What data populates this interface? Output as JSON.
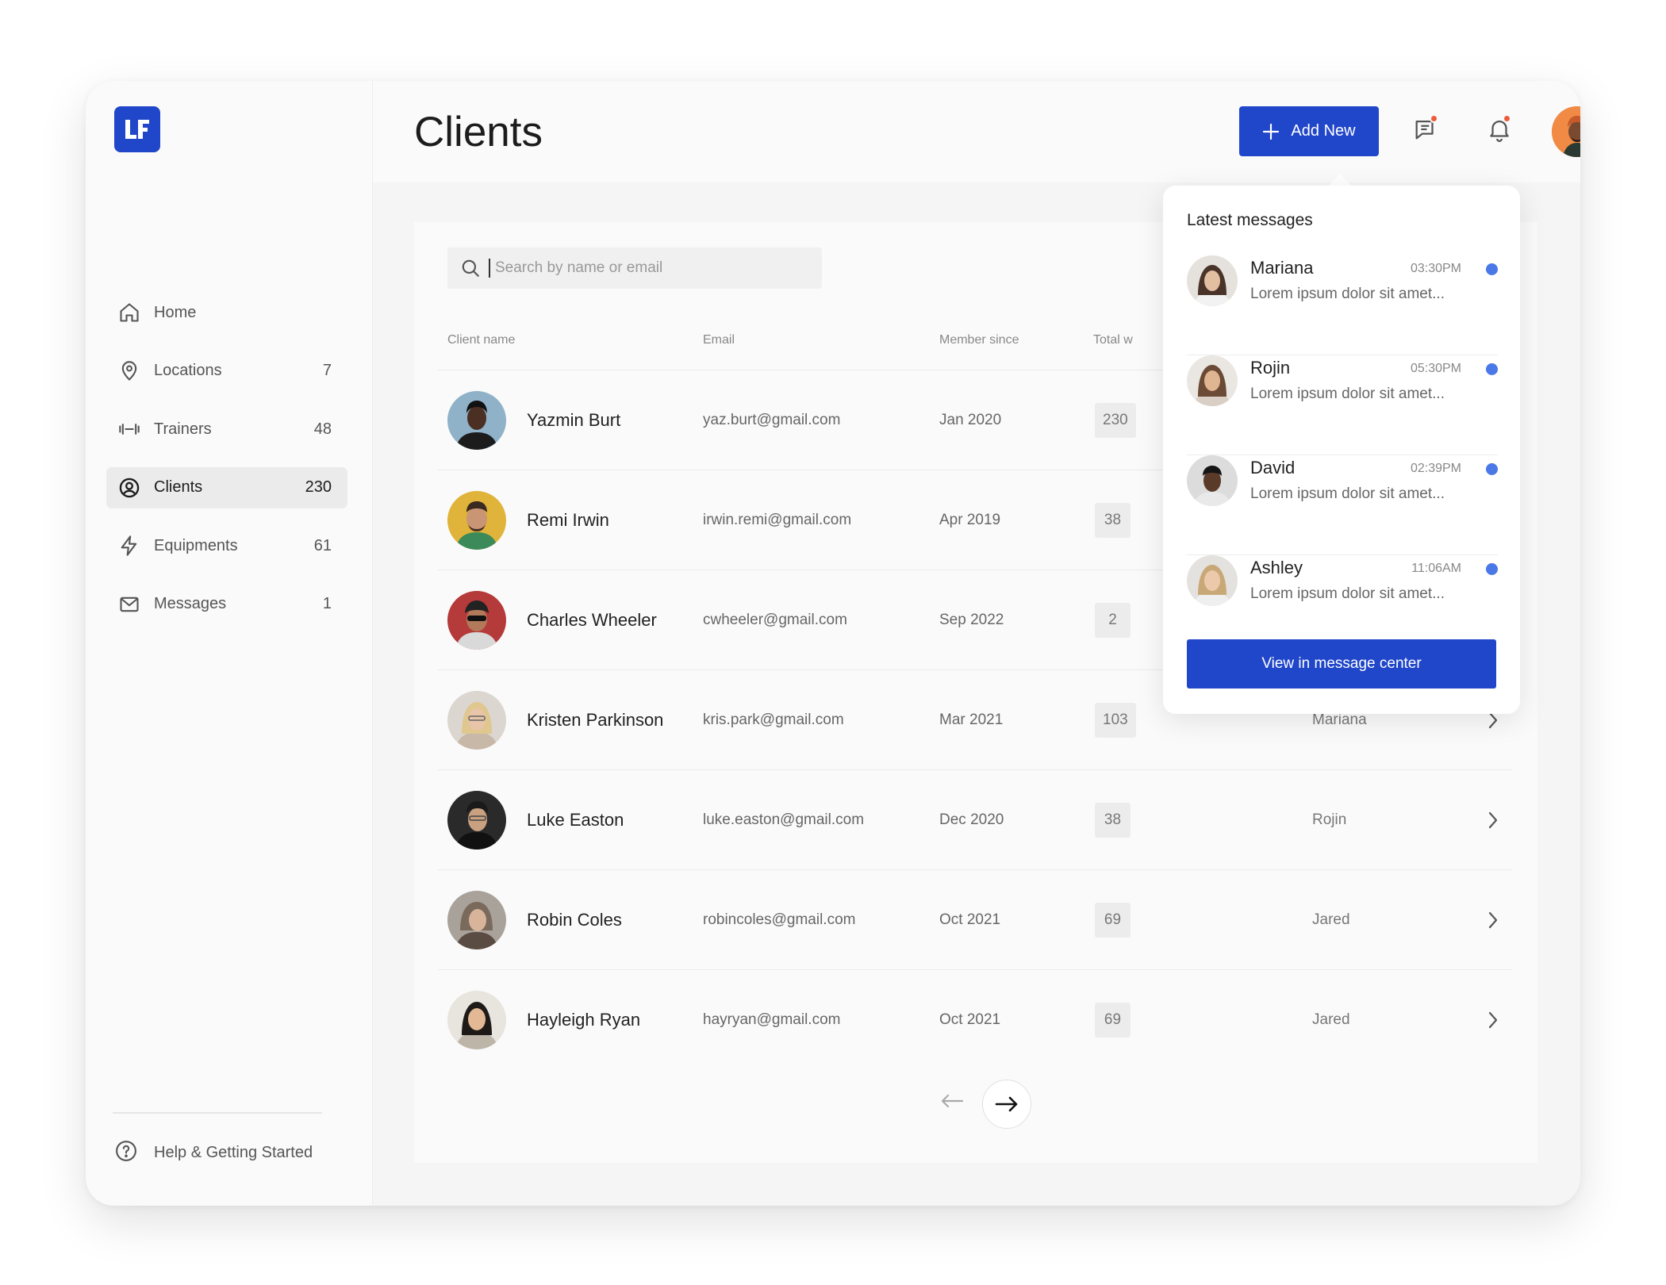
{
  "app": {
    "logo_text": "LF"
  },
  "sidebar": {
    "items": [
      {
        "label": "Home",
        "count": "",
        "icon": "home-icon"
      },
      {
        "label": "Locations",
        "count": "7",
        "icon": "location-pin-icon"
      },
      {
        "label": "Trainers",
        "count": "48",
        "icon": "dumbbell-icon"
      },
      {
        "label": "Clients",
        "count": "230",
        "icon": "user-circle-icon",
        "active": true
      },
      {
        "label": "Equipments",
        "count": "61",
        "icon": "lightning-icon"
      },
      {
        "label": "Messages",
        "count": "1",
        "icon": "mail-icon"
      }
    ],
    "help_label": "Help & Getting Started"
  },
  "header": {
    "title": "Clients",
    "add_label": "Add New"
  },
  "search": {
    "placeholder": "Search by name or email"
  },
  "table": {
    "columns": [
      "Client name",
      "Email",
      "Member since",
      "Total w"
    ],
    "rows": [
      {
        "name": "Yazmin Burt",
        "email": "yaz.burt@gmail.com",
        "since": "Jan 2020",
        "total": "230",
        "trainer": ""
      },
      {
        "name": "Remi Irwin",
        "email": "irwin.remi@gmail.com",
        "since": "Apr 2019",
        "total": "38",
        "trainer": ""
      },
      {
        "name": "Charles Wheeler",
        "email": "cwheeler@gmail.com",
        "since": "Sep 2022",
        "total": "2",
        "trainer": ""
      },
      {
        "name": "Kristen Parkinson",
        "email": "kris.park@gmail.com",
        "since": "Mar 2021",
        "total": "103",
        "trainer": "Mariana"
      },
      {
        "name": "Luke Easton",
        "email": "luke.easton@gmail.com",
        "since": "Dec 2020",
        "total": "38",
        "trainer": "Rojin"
      },
      {
        "name": "Robin Coles",
        "email": "robincoles@gmail.com",
        "since": "Oct 2021",
        "total": "69",
        "trainer": "Jared"
      },
      {
        "name": "Hayleigh Ryan",
        "email": "hayryan@gmail.com",
        "since": "Oct 2021",
        "total": "69",
        "trainer": "Jared"
      }
    ]
  },
  "messages_popup": {
    "title": "Latest messages",
    "items": [
      {
        "name": "Mariana",
        "time": "03:30PM",
        "text": "Lorem ipsum dolor sit amet..."
      },
      {
        "name": "Rojin",
        "time": "05:30PM",
        "text": "Lorem ipsum dolor sit amet..."
      },
      {
        "name": "David",
        "time": "02:39PM",
        "text": "Lorem ipsum dolor sit amet..."
      },
      {
        "name": "Ashley",
        "time": "11:06AM",
        "text": "Lorem ipsum dolor sit amet..."
      }
    ],
    "button_label": "View in message center"
  },
  "colors": {
    "accent": "#2046c9",
    "unread": "#4a78e6",
    "notification": "#ef5a3c"
  }
}
